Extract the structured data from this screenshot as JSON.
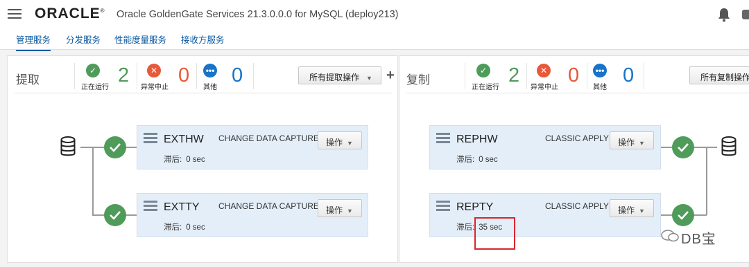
{
  "header": {
    "logo": "ORACLE",
    "app_title": "Oracle GoldenGate Services 21.3.0.0.0 for MySQL (deploy213)"
  },
  "tabs": [
    {
      "label": "管理服务",
      "active": true
    },
    {
      "label": "分发服务"
    },
    {
      "label": "性能度量服务"
    },
    {
      "label": "接收方服务"
    }
  ],
  "extract_panel": {
    "title": "提取",
    "stats": {
      "running": {
        "label": "正在运行",
        "value": "2"
      },
      "abended": {
        "label": "异常中止",
        "value": "0"
      },
      "other": {
        "label": "其他",
        "value": "0"
      }
    },
    "actions_button": "所有提取操作",
    "processes": [
      {
        "name": "EXTHW",
        "type": "CHANGE DATA CAPTURE",
        "lag_label": "滞后:",
        "lag_value": "0 sec",
        "op_button": "操作"
      },
      {
        "name": "EXTTY",
        "type": "CHANGE DATA CAPTURE",
        "lag_label": "滞后:",
        "lag_value": "0 sec",
        "op_button": "操作"
      }
    ]
  },
  "replicat_panel": {
    "title": "复制",
    "stats": {
      "running": {
        "label": "正在运行",
        "value": "2"
      },
      "abended": {
        "label": "异常中止",
        "value": "0"
      },
      "other": {
        "label": "其他",
        "value": "0"
      }
    },
    "actions_button": "所有复制操作",
    "processes": [
      {
        "name": "REPHW",
        "type": "CLASSIC APPLY",
        "lag_label": "滞后:",
        "lag_value": "0 sec",
        "op_button": "操作"
      },
      {
        "name": "REPTY",
        "type": "CLASSIC APPLY",
        "lag_label": "滞后:",
        "lag_value": "35 sec",
        "op_button": "操作"
      }
    ]
  },
  "watermark": "DB宝",
  "colors": {
    "running": "#4e9b5a",
    "abended": "#e8583a",
    "other": "#1874c9",
    "accent": "#0b5aa2",
    "highlight": "#d9262c"
  }
}
